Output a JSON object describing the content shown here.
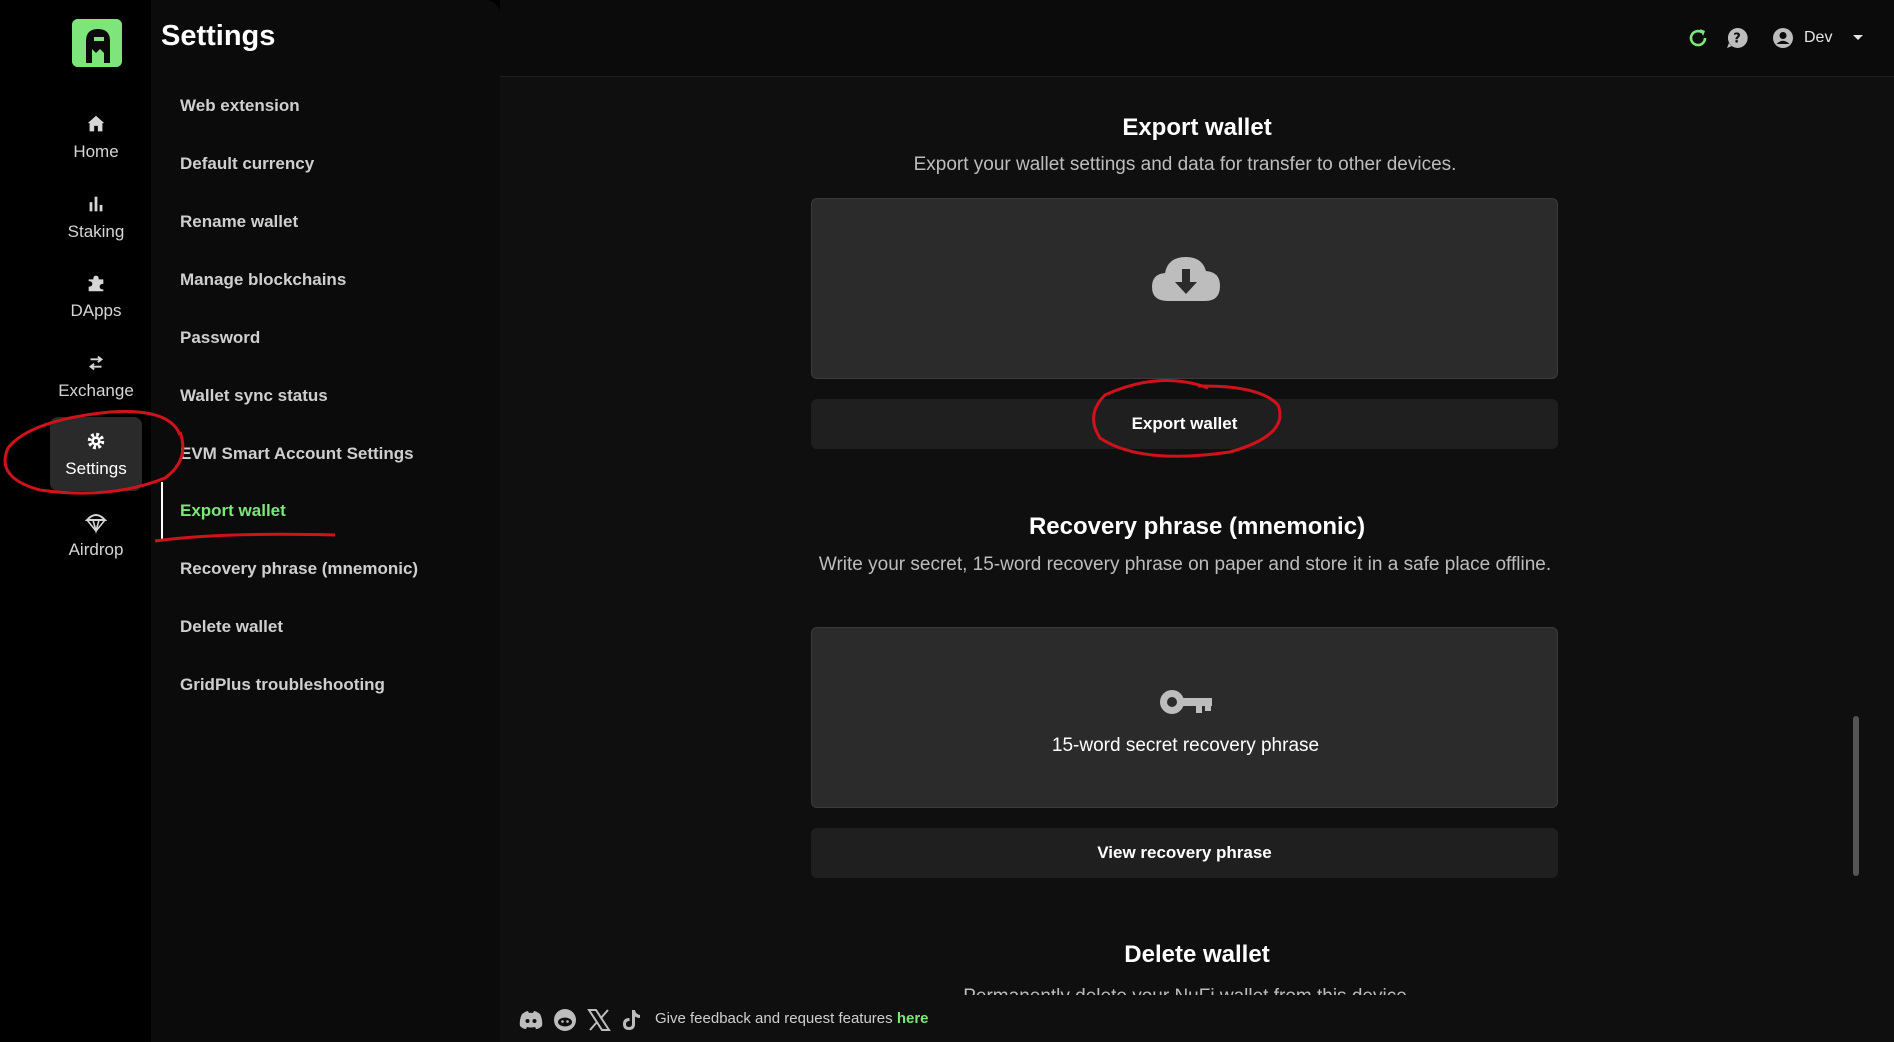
{
  "rail": {
    "items": [
      {
        "label": "Home",
        "icon": "home-icon"
      },
      {
        "label": "Staking",
        "icon": "bar-chart-icon"
      },
      {
        "label": "DApps",
        "icon": "puzzle-icon"
      },
      {
        "label": "Exchange",
        "icon": "swap-icon"
      },
      {
        "label": "Settings",
        "icon": "gear-icon"
      },
      {
        "label": "Airdrop",
        "icon": "parachute-icon"
      }
    ]
  },
  "panel": {
    "title": "Settings",
    "items": [
      "Web extension",
      "Default currency",
      "Rename wallet",
      "Manage blockchains",
      "Password",
      "Wallet sync status",
      "EVM Smart Account Settings",
      "Export wallet",
      "Recovery phrase (mnemonic)",
      "Delete wallet",
      "GridPlus troubleshooting"
    ],
    "active_index": 7
  },
  "topbar": {
    "user_name": "Dev"
  },
  "export": {
    "title": "Export wallet",
    "subtitle": "Export your wallet settings and data for transfer to other devices.",
    "button": "Export wallet"
  },
  "recovery": {
    "title": "Recovery phrase (mnemonic)",
    "subtitle": "Write your secret, 15-word recovery phrase on paper and store it in a safe place offline.",
    "card_text": "15-word secret recovery phrase",
    "button": "View recovery phrase"
  },
  "delete": {
    "title": "Delete wallet",
    "subtitle_partial": "Permanently delete your NuFi wallet from this device"
  },
  "footer": {
    "text": "Give feedback and request features",
    "link": "here"
  },
  "colors": {
    "accent": "#7ee57a",
    "annotation": "#d0121b"
  }
}
